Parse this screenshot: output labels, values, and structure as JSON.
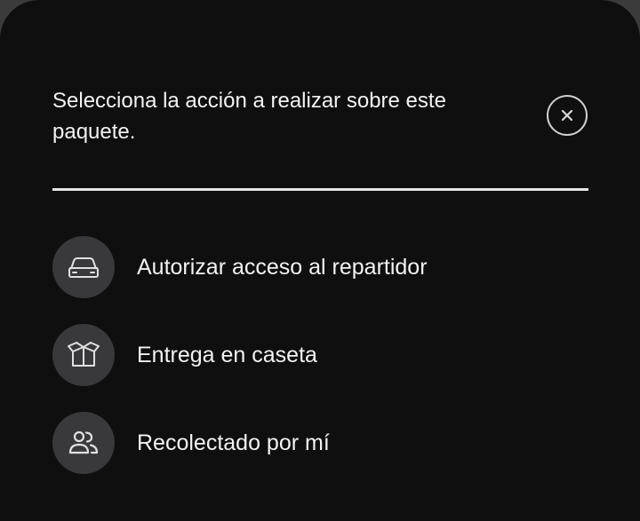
{
  "sheet": {
    "title": "Selecciona la acción a realizar sobre este paquete.",
    "close_icon": "close-circle-icon"
  },
  "options": [
    {
      "icon": "car-icon",
      "label": "Autorizar acceso al repartidor"
    },
    {
      "icon": "open-box-icon",
      "label": "Entrega en caseta"
    },
    {
      "icon": "people-icon",
      "label": "Recolectado por mí"
    }
  ],
  "colors": {
    "background": "#0f0f10",
    "icon_circle": "#39393c",
    "text": "#f2f2f2"
  }
}
